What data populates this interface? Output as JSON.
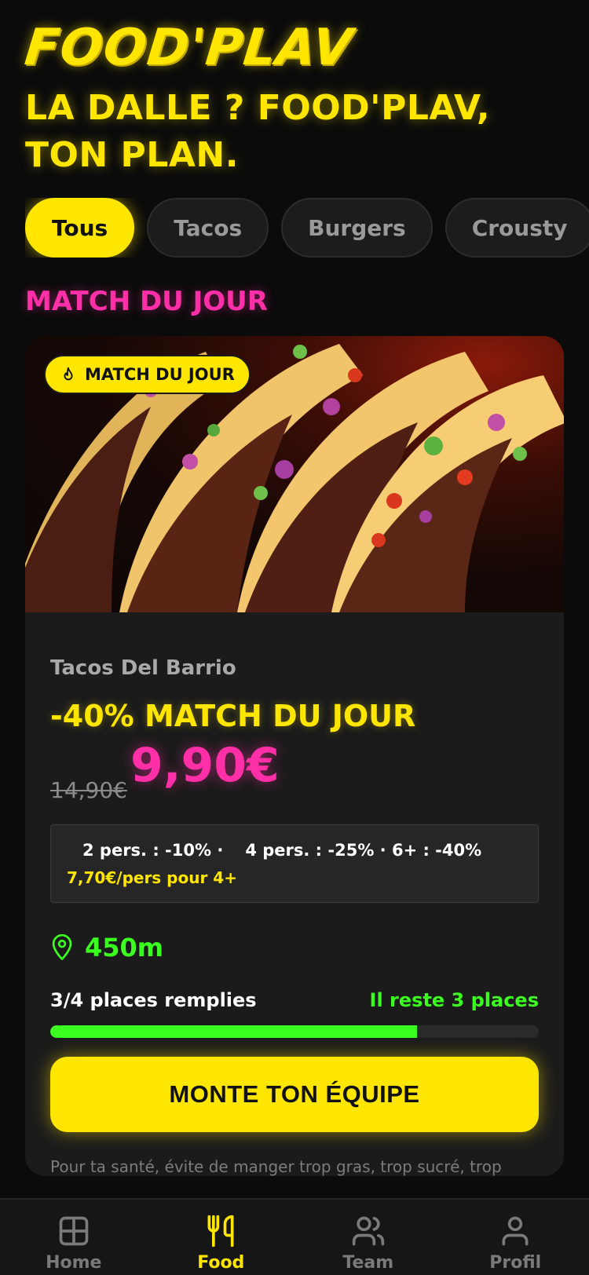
{
  "app": {
    "logo": "FOOD'PLAV",
    "tagline": "LA DALLE ? FOOD'PLAV, TON PLAN."
  },
  "filters": {
    "chips": [
      "Tous",
      "Tacos",
      "Burgers",
      "Crousty"
    ],
    "selected": "Tous"
  },
  "section": {
    "title": "MATCH DU JOUR"
  },
  "offer": {
    "badge": "MATCH DU JOUR",
    "restaurant": "Tacos Del Barrio",
    "deal": "-40% MATCH DU JOUR",
    "old_price": "14,90€",
    "new_price": "9,90€",
    "promo": {
      "tier_2": "2 pers. : -10% ·",
      "tier_4_6": "4 pers. : -25% · 6+ : -40%",
      "per_person": "7,70€/pers pour 4+"
    },
    "distance": "450m",
    "places_filled": "3/4 places remplies",
    "places_left": "Il reste 3 places",
    "fill_percent": 75,
    "cta": "MONTE TON ÉQUIPE",
    "health_notice": "Pour ta santé, évite de manger trop gras, trop sucré, trop salé. mangerbouger.fr"
  },
  "tabbar": {
    "items": [
      {
        "label": "Home",
        "icon": "grid-icon"
      },
      {
        "label": "Food",
        "icon": "utensils-icon"
      },
      {
        "label": "Team",
        "icon": "users-icon"
      },
      {
        "label": "Profil",
        "icon": "user-icon"
      }
    ],
    "active": "Food"
  },
  "colors": {
    "accent_yellow": "#ffe600",
    "accent_pink": "#ff2fa8",
    "accent_green": "#3aff1f",
    "background": "#0b0b0b",
    "card": "#1b1b1b"
  }
}
